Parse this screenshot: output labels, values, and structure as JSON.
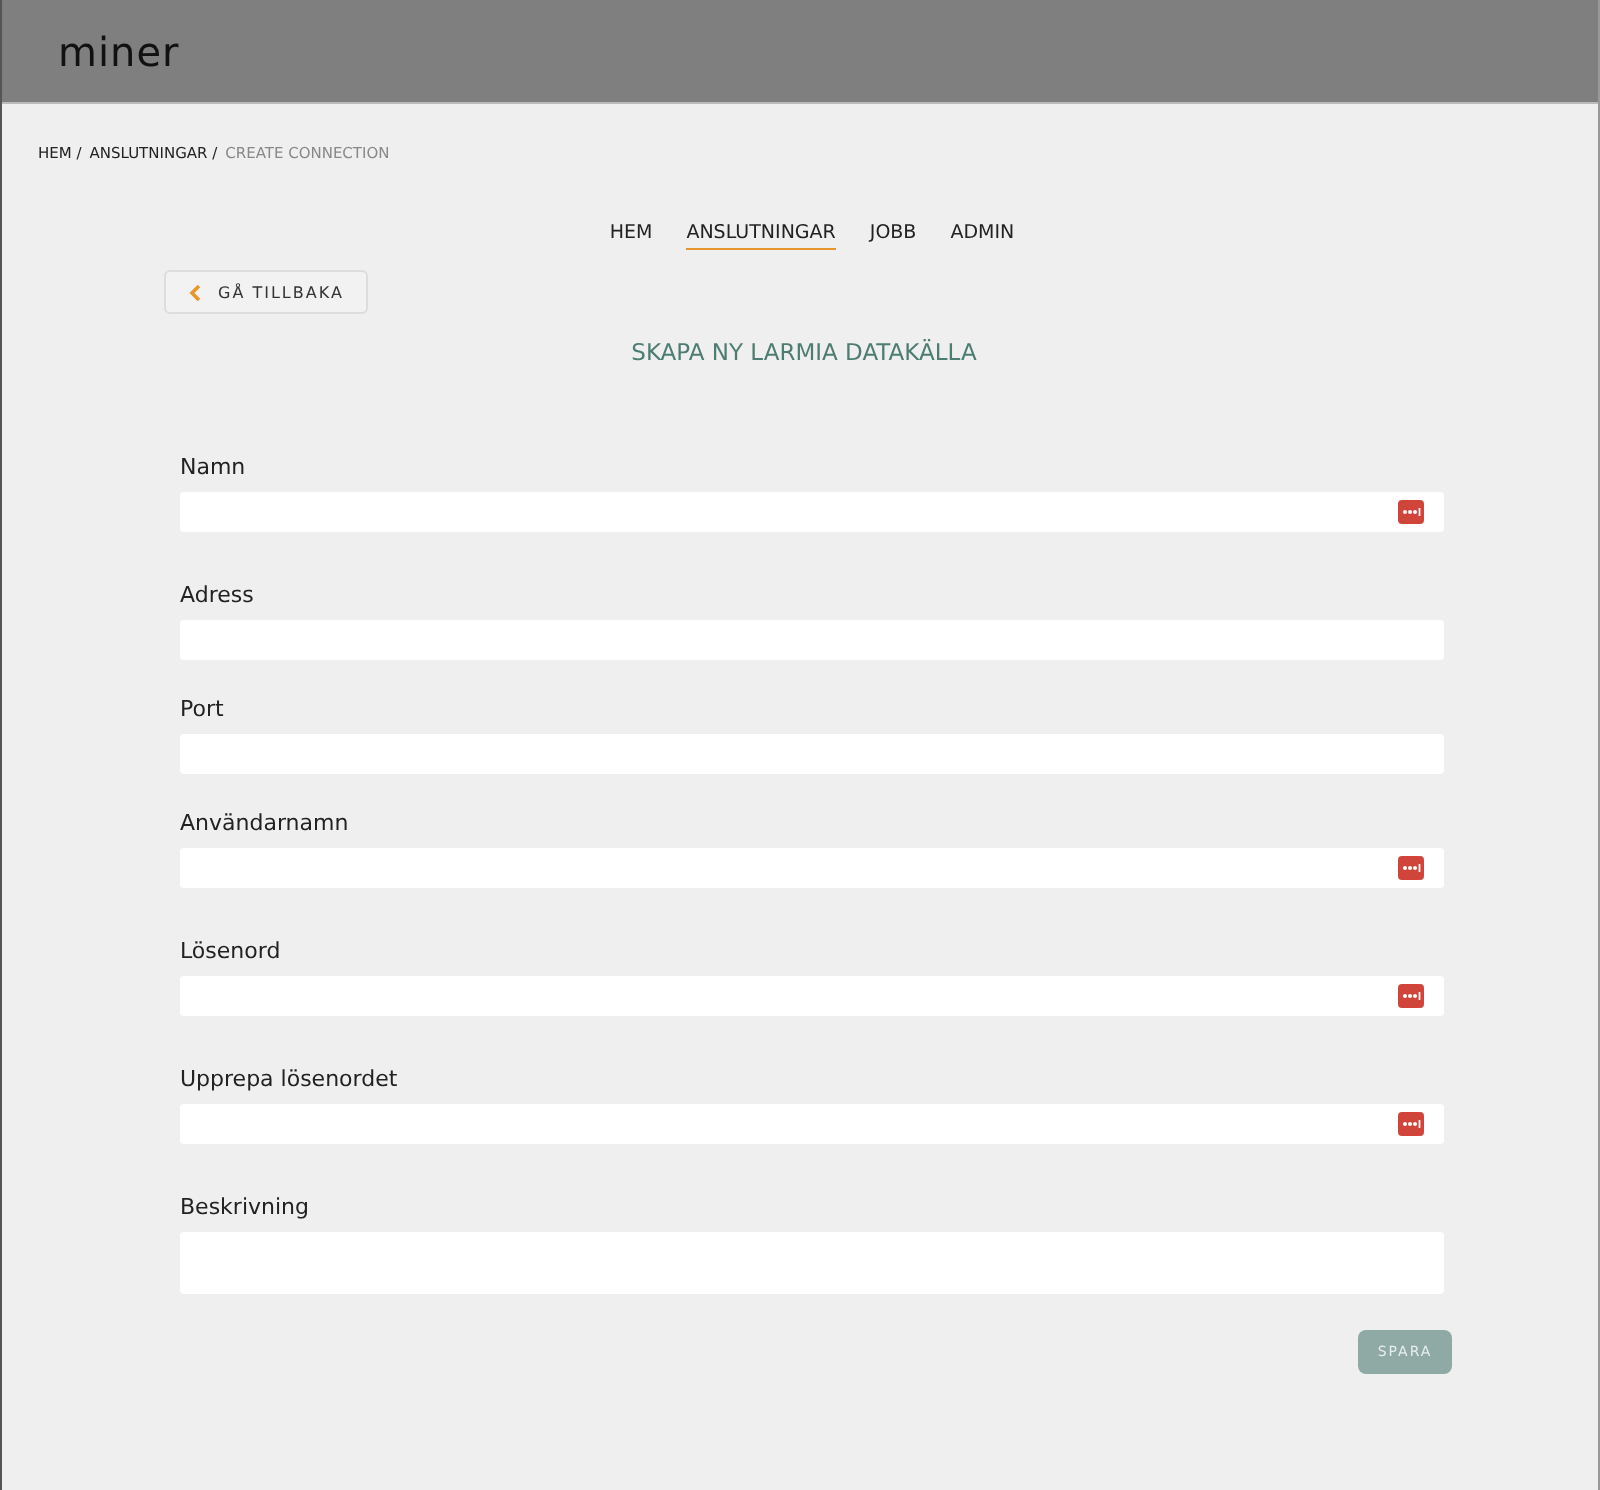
{
  "header": {
    "logo": "miner"
  },
  "breadcrumb": [
    {
      "label": "HEM /",
      "current": false
    },
    {
      "label": "ANSLUTNINGAR /",
      "current": false
    },
    {
      "label": "CREATE CONNECTION",
      "current": true
    }
  ],
  "nav": [
    {
      "label": "HEM",
      "selected": false
    },
    {
      "label": "ANSLUTNINGAR",
      "selected": true
    },
    {
      "label": "JOBB",
      "selected": false
    },
    {
      "label": "ADMIN",
      "selected": false
    }
  ],
  "back_button": {
    "label": "GÅ TILLBAKA"
  },
  "title": "SKAPA NY LARMIA DATAKÄLLA",
  "fields": [
    {
      "label": "Namn",
      "kind": "text",
      "autofill_icon": true
    },
    {
      "label": "Adress",
      "kind": "text",
      "autofill_icon": false
    },
    {
      "label": "Port",
      "kind": "text",
      "autofill_icon": false
    },
    {
      "label": "Användarnamn",
      "kind": "text",
      "autofill_icon": true
    },
    {
      "label": "Lösenord",
      "kind": "password",
      "autofill_icon": true
    },
    {
      "label": "Upprepa lösenordet",
      "kind": "password",
      "autofill_icon": true
    },
    {
      "label": "Beskrivning",
      "kind": "textarea",
      "autofill_icon": false
    }
  ],
  "save_button": {
    "label": "SPARA",
    "disabled": true
  }
}
